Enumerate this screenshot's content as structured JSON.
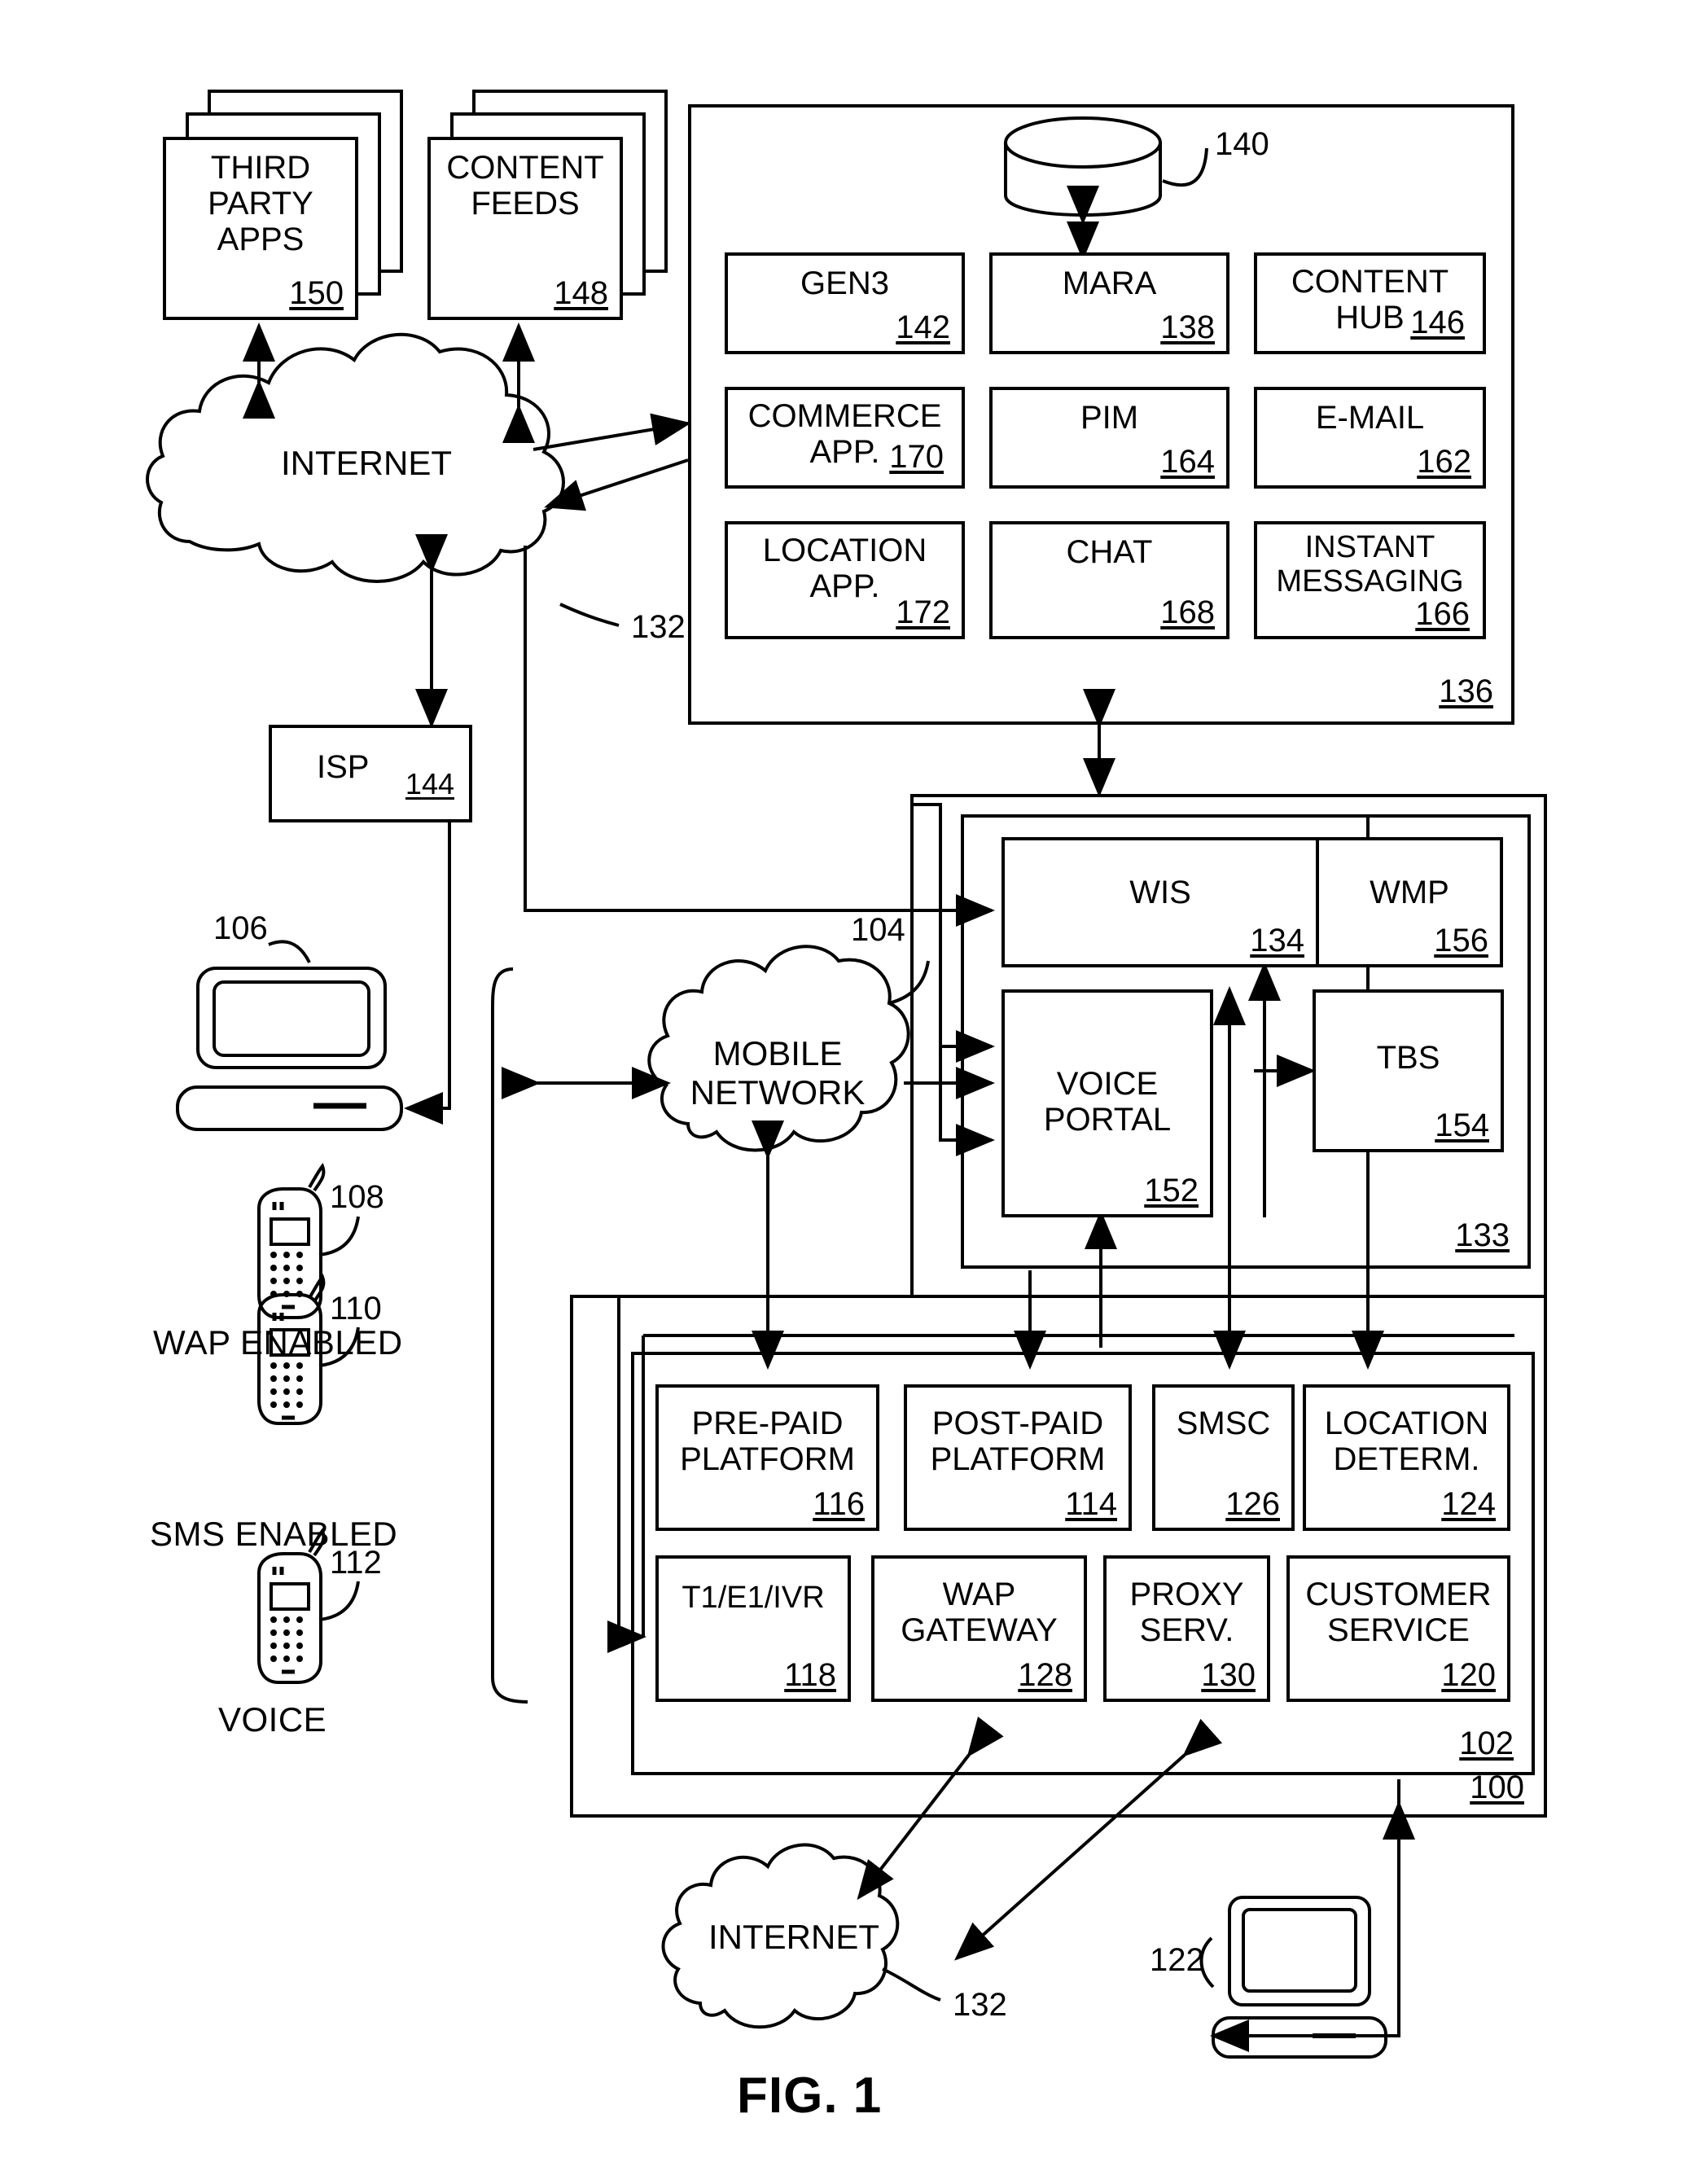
{
  "figure": {
    "caption": "FIG. 1"
  },
  "stacks": {
    "third_party_apps": {
      "label": "THIRD\nPARTY\nAPPS",
      "ref": "150"
    },
    "content_feeds": {
      "label": "CONTENT\nFEEDS",
      "ref": "148"
    }
  },
  "clouds": {
    "internet_top": {
      "label": "INTERNET",
      "ref": "132"
    },
    "mobile_network": {
      "label": "MOBILE\nNETWORK",
      "ref": "104"
    },
    "internet_bottom": {
      "label": "INTERNET",
      "ref": "132"
    }
  },
  "isp": {
    "label": "ISP",
    "ref": "144"
  },
  "database": {
    "ref": "140"
  },
  "devices": {
    "computer_top": {
      "ref": "106"
    },
    "wap_phone": {
      "ref": "108",
      "caption": "WAP ENABLED"
    },
    "sms_phone": {
      "ref": "110",
      "caption": "SMS ENABLED"
    },
    "voice_phone": {
      "ref": "112",
      "caption": "VOICE"
    },
    "computer_bottom": {
      "ref": "122"
    }
  },
  "services_panel": {
    "ref": "136",
    "boxes": [
      {
        "label": "GEN3",
        "ref": "142"
      },
      {
        "label": "MARA",
        "ref": "138"
      },
      {
        "label": "CONTENT\nHUB",
        "ref": "146",
        "inline_ref": true
      },
      {
        "label": "COMMERCE\nAPP.",
        "ref": "170",
        "inline_ref": true
      },
      {
        "label": "PIM",
        "ref": "164"
      },
      {
        "label": "E-MAIL",
        "ref": "162"
      },
      {
        "label": "LOCATION\nAPP.",
        "ref": "172"
      },
      {
        "label": "CHAT",
        "ref": "168"
      },
      {
        "label": "INSTANT\nMESSAGING",
        "ref": "166"
      }
    ]
  },
  "middle_panel": {
    "ref": "133",
    "boxes": [
      {
        "label": "WIS",
        "ref": "134"
      },
      {
        "label": "WMP",
        "ref": "156"
      },
      {
        "label": "VOICE\nPORTAL",
        "ref": "152"
      },
      {
        "label": "TBS",
        "ref": "154"
      }
    ]
  },
  "infrastructure_panel": {
    "ref": "102",
    "outer_ref": "100",
    "boxes": [
      {
        "label": "PRE-PAID\nPLATFORM",
        "ref": "116"
      },
      {
        "label": "POST-PAID\nPLATFORM",
        "ref": "114"
      },
      {
        "label": "SMSC",
        "ref": "126"
      },
      {
        "label": "LOCATION\nDETERM.",
        "ref": "124"
      },
      {
        "label": "T1/E1/IVR",
        "ref": "118"
      },
      {
        "label": "WAP\nGATEWAY",
        "ref": "128",
        "inline_ref": true
      },
      {
        "label": "PROXY\nSERV.",
        "ref": "130",
        "inline_ref": true
      },
      {
        "label": "CUSTOMER\nSERVICE",
        "ref": "120",
        "inline_ref": true
      }
    ]
  },
  "colors": {
    "line": "#000000",
    "background": "#ffffff"
  }
}
